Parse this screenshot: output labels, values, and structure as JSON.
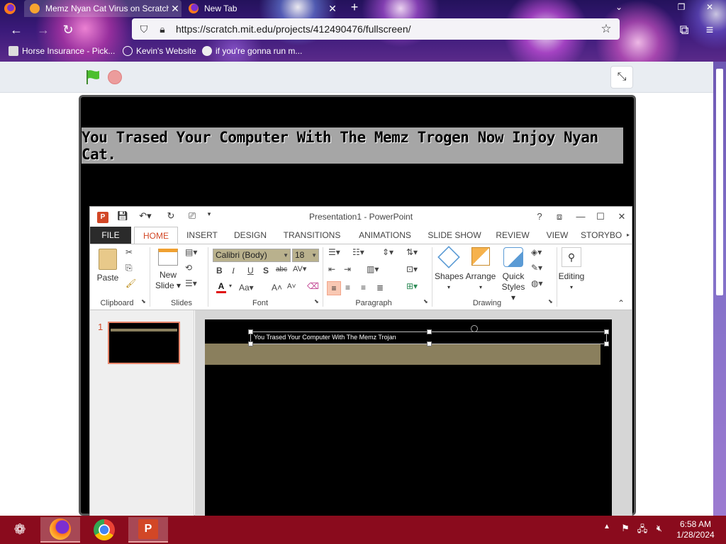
{
  "browser": {
    "tabs": [
      {
        "title": "Memz Nyan Cat Virus on Scratch",
        "active": true
      },
      {
        "title": "New Tab",
        "active": false
      }
    ],
    "url": "https://scratch.mit.edu/projects/412490476/fullscreen/",
    "bookmarks": [
      "Horse Insurance - Pick...",
      "Kevin's Website",
      "if you're gonna run m..."
    ]
  },
  "scratch": {
    "banner_text": "You Trased Your Computer With The Memz Trogen Now Injoy Nyan Cat."
  },
  "powerpoint": {
    "window_title": "Presentation1 - PowerPoint",
    "tabs": [
      "FILE",
      "HOME",
      "INSERT",
      "DESIGN",
      "TRANSITIONS",
      "ANIMATIONS",
      "SLIDE SHOW",
      "REVIEW",
      "VIEW",
      "STORYBO"
    ],
    "groups": {
      "clipboard": "Clipboard",
      "slides": "Slides",
      "font": "Font",
      "paragraph": "Paragraph",
      "drawing": "Drawing"
    },
    "buttons": {
      "paste": "Paste",
      "new_slide_1": "New",
      "new_slide_2": "Slide",
      "shapes": "Shapes",
      "arrange": "Arrange",
      "quick_styles_1": "Quick",
      "quick_styles_2": "Styles",
      "editing": "Editing"
    },
    "font_name": "Calibri (Body)",
    "font_size": "18",
    "slide_number": "1",
    "slide_text": "You Trased Your Computer With The Memz Trojan"
  },
  "taskbar": {
    "time": "6:58 AM",
    "date": "1/28/2024"
  },
  "colors": {
    "ppt_accent": "#d24726",
    "taskbar": "#8a0b1d",
    "slide_band": "#8a7f5d"
  }
}
